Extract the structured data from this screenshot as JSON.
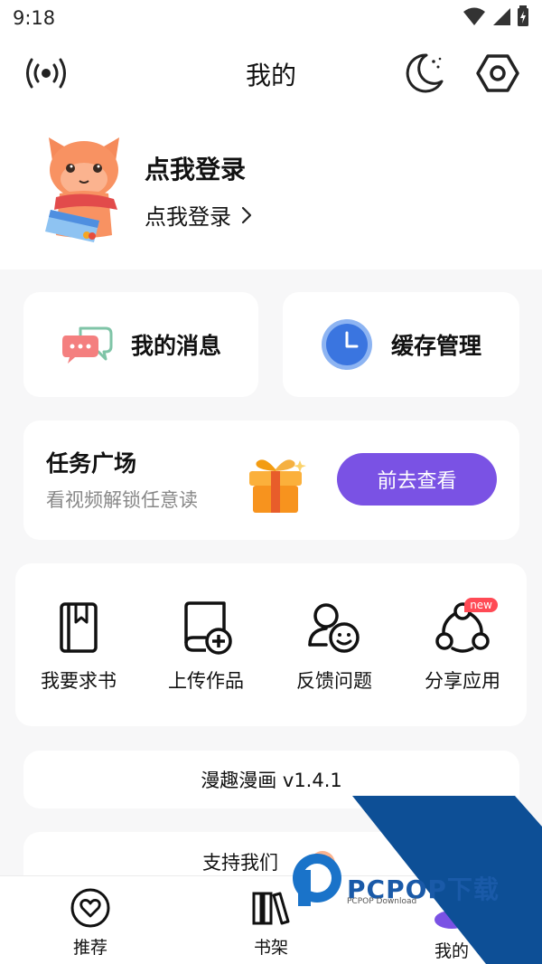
{
  "status_bar": {
    "time": "9:18"
  },
  "header": {
    "title": "我的"
  },
  "profile": {
    "title": "点我登录",
    "subtitle": "点我登录"
  },
  "quick_cards": [
    {
      "label": "我的消息",
      "icon": "chat-bubbles-icon"
    },
    {
      "label": "缓存管理",
      "icon": "clock-icon"
    }
  ],
  "task": {
    "title": "任务广场",
    "subtitle": "看视频解锁任意读",
    "button": "前去查看"
  },
  "tools": [
    {
      "label": "我要求书",
      "icon": "book-request-icon"
    },
    {
      "label": "上传作品",
      "icon": "upload-icon"
    },
    {
      "label": "反馈问题",
      "icon": "feedback-icon"
    },
    {
      "label": "分享应用",
      "icon": "share-icon",
      "badge": "new"
    }
  ],
  "version": "漫趣漫画 v1.4.1",
  "support": "支持我们",
  "tabs": [
    {
      "label": "推荐",
      "icon": "heart-icon"
    },
    {
      "label": "书架",
      "icon": "bookshelf-icon"
    },
    {
      "label": "我的",
      "icon": "profile-icon"
    }
  ],
  "watermark": {
    "brand": "PCPOP下载",
    "sub": "PCPOP Download"
  },
  "colors": {
    "accent": "#7a52e4",
    "clock": "#3a75e0",
    "watermark": "#0d4f96"
  }
}
